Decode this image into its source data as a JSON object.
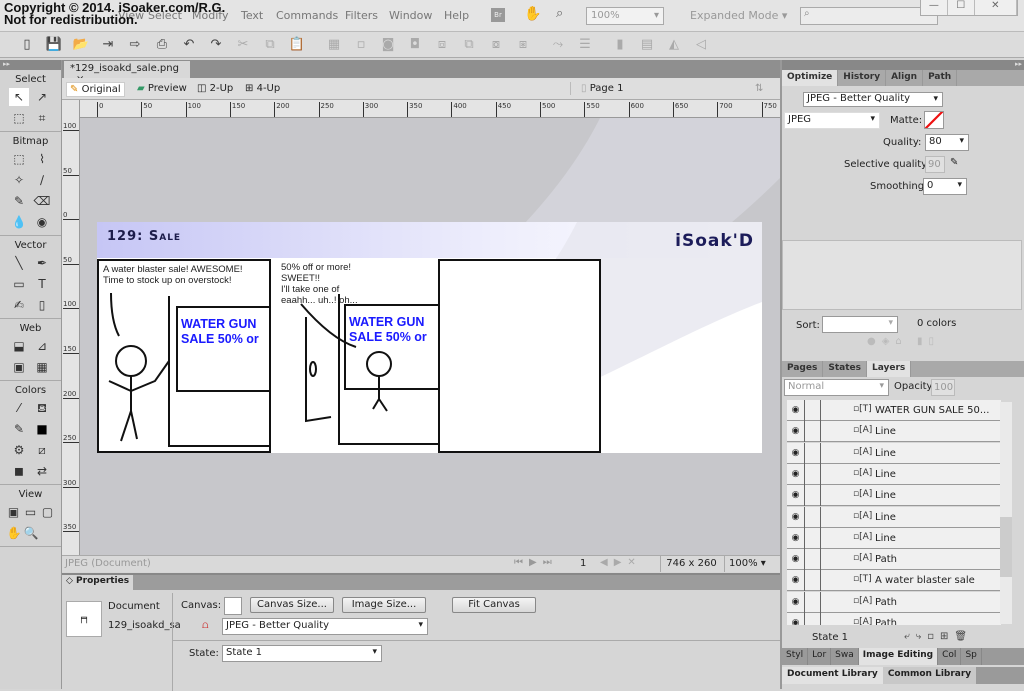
{
  "watermark": {
    "line1": "Copyright © 2014. iSoaker.com/R.G.",
    "line2": "Not for redistribution."
  },
  "menu": [
    "View",
    "Select",
    "Modify",
    "Text",
    "Commands",
    "Filters",
    "Window",
    "Help"
  ],
  "menubar": {
    "zoom": "100%",
    "mode": "Expanded Mode ▾",
    "bridge": "Br"
  },
  "window_buttons": [
    "—",
    "☐",
    "✕"
  ],
  "toolbar_icons": [
    "new-icon",
    "save-icon",
    "open-icon",
    "import-icon",
    "export-icon",
    "print-icon",
    "undo-icon",
    "redo-icon",
    "cut-icon",
    "copy-icon",
    "paste-icon",
    "group-icon",
    "ungroup-icon",
    "join-icon",
    "split-icon",
    "bring-front-icon",
    "send-back-icon",
    "forward-icon",
    "backward-icon",
    "rotate-icon",
    "align-icon",
    "flip-icon",
    "distort-icon",
    "flip-horizontal-icon",
    "flip-vertical-icon"
  ],
  "tools": {
    "sections": [
      {
        "title": "Select",
        "items": [
          "↖",
          "↗",
          "⬚",
          "⌗"
        ]
      },
      {
        "title": "Bitmap",
        "items": [
          "⬚",
          "⌇",
          "✧",
          "∕",
          "✎",
          "⌫",
          "💧",
          "◉"
        ]
      },
      {
        "title": "Vector",
        "items": [
          "╲",
          "✒",
          "▭",
          "T",
          "✍",
          "▯"
        ]
      },
      {
        "title": "Web",
        "items": [
          "⬓",
          "⊿",
          "▣",
          "▦"
        ]
      },
      {
        "title": "Colors",
        "items": [
          "⁄",
          "⛾",
          "✎",
          "■",
          "⚙",
          "⧄",
          "◼",
          "⇄"
        ]
      },
      {
        "title": "View",
        "items": [
          "▣",
          "▭",
          "▢",
          "✋",
          "🔍"
        ]
      }
    ],
    "stroke_color": "#000000"
  },
  "document": {
    "tab": "*129_isoakd_sale.png",
    "close": "×",
    "views": [
      "Original",
      "Preview",
      "2-Up",
      "4-Up"
    ],
    "page": "Page 1"
  },
  "rulers": {
    "h": [
      "0",
      "50",
      "100",
      "150",
      "200",
      "250",
      "300",
      "350",
      "400",
      "450",
      "500",
      "550",
      "600",
      "650",
      "700",
      "750"
    ],
    "v": [
      "100",
      "50",
      "0",
      "50",
      "100",
      "150",
      "200",
      "250",
      "300",
      "350"
    ]
  },
  "comic": {
    "title": "129: Sale",
    "logo": "iSoak'D",
    "panel1_text": [
      "A water blaster sale!  AWESOME!",
      "Time to stock up on overstock!"
    ],
    "panel2_text": [
      "50% off or more!",
      "SWEET!!",
      "I'll take one of",
      "eaahh... uh..! oh..."
    ],
    "sign": [
      "WATER GUN",
      "SALE 50% or"
    ],
    "sign_color": "#1a1aff"
  },
  "status": {
    "left": "JPEG (Document)",
    "frame": "1",
    "size": "746 x 260",
    "zoom": "100%"
  },
  "properties": {
    "tab": "◇ Properties",
    "type": "Document",
    "name": "129_isoakd_sa",
    "canvas_label": "Canvas:",
    "canvas_size": "Canvas Size...",
    "image_size": "Image Size...",
    "fit_canvas": "Fit Canvas",
    "optimize": "JPEG - Better Quality",
    "state_label": "State:",
    "state": "State 1"
  },
  "optimize": {
    "tabs": [
      "Optimize",
      "History",
      "Align",
      "Path"
    ],
    "preset": "JPEG - Better Quality",
    "format": "JPEG",
    "matte_label": "Matte:",
    "quality_label": "Quality:",
    "quality": "80",
    "selective_label": "Selective quality:",
    "selective": "90",
    "smoothing_label": "Smoothing:",
    "smoothing": "0",
    "sort_label": "Sort:",
    "colors": "0 colors"
  },
  "layers": {
    "tabs": [
      "Pages",
      "States",
      "Layers"
    ],
    "blend": "Normal",
    "opacity_label": "Opacity",
    "opacity": "100",
    "rows": [
      {
        "type": "text",
        "name": "WATER GUN SALE 50..."
      },
      {
        "type": "shape",
        "name": "Line"
      },
      {
        "type": "shape",
        "name": "Line"
      },
      {
        "type": "shape",
        "name": "Line"
      },
      {
        "type": "shape",
        "name": "Line"
      },
      {
        "type": "shape",
        "name": "Line"
      },
      {
        "type": "shape",
        "name": "Line"
      },
      {
        "type": "shape",
        "name": "Path"
      },
      {
        "type": "text",
        "name": "A water blaster sale"
      },
      {
        "type": "shape",
        "name": "Path"
      },
      {
        "type": "shape",
        "name": "Path"
      }
    ],
    "state": "State 1"
  },
  "bottom_tabs": [
    "Styl",
    "Lor",
    "Swa",
    "Image Editing",
    "Col",
    "Sp"
  ],
  "library_tabs": [
    "Document Library",
    "Common Library"
  ]
}
